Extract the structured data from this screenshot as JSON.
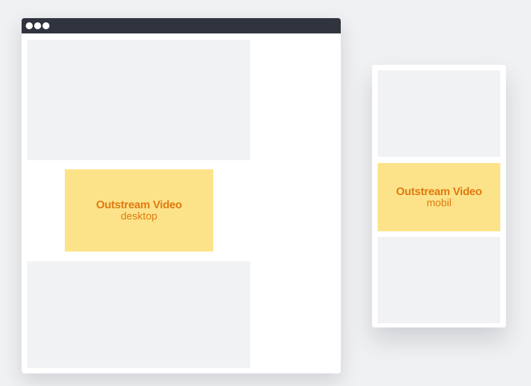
{
  "desktop": {
    "ad": {
      "title": "Outstream Video",
      "subtitle": "desktop"
    }
  },
  "mobile": {
    "ad": {
      "title": "Outstream Video",
      "subtitle": "mobil"
    }
  },
  "colors": {
    "background": "#f0f1f3",
    "browser_bar": "#30343f",
    "placeholder": "#f1f2f4",
    "ad_fill": "#fce38a",
    "ad_text": "#e07a10"
  }
}
